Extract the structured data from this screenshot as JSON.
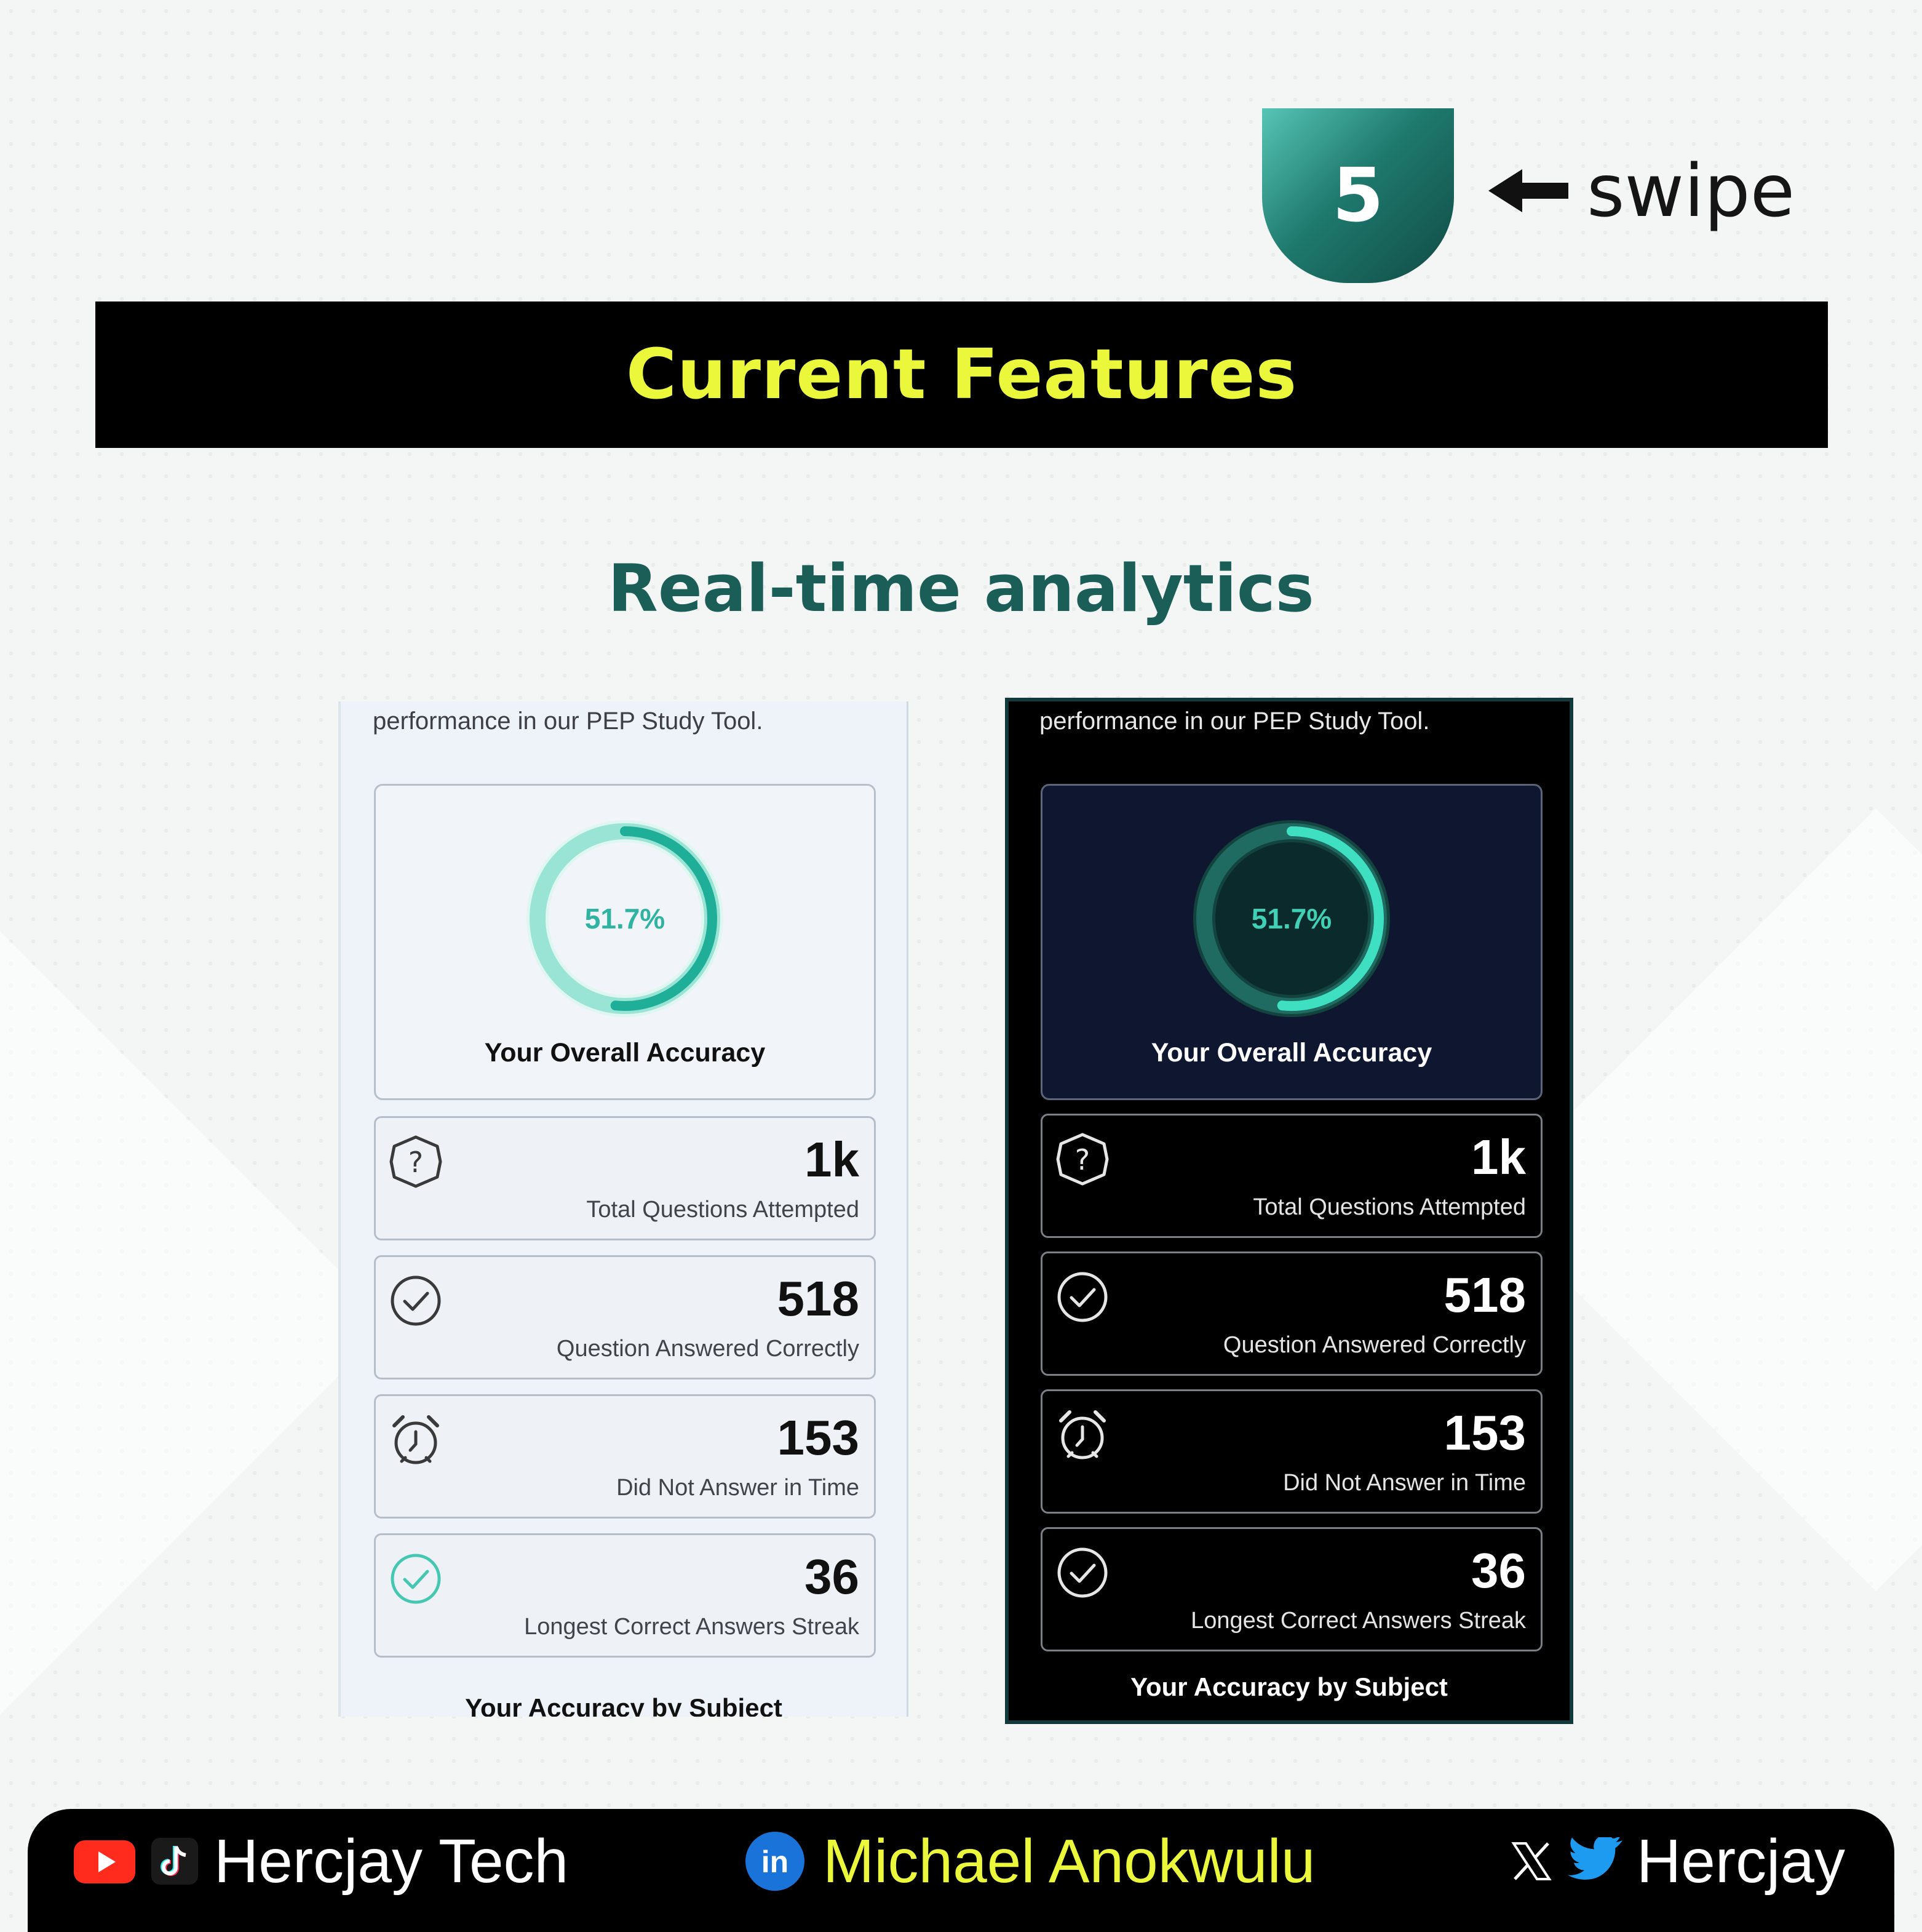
{
  "page_badge": {
    "number": "5"
  },
  "swipe": {
    "label": "swipe"
  },
  "banner": {
    "title": "Current Features"
  },
  "subtitle": "Real-time analytics",
  "colors": {
    "banner_text": "#eaf73a",
    "subtitle": "#1b5e58",
    "accent_teal": "#31b3a1"
  },
  "panels": {
    "light": {
      "intro_text": "performance in our PEP Study Tool.",
      "accuracy": {
        "percent_label": "51.7%",
        "value": 0.517,
        "title": "Your Overall Accuracy"
      },
      "stats": [
        {
          "icon": "question-icon",
          "value": "1k",
          "label": "Total Questions Attempted"
        },
        {
          "icon": "check-circle-icon",
          "value": "518",
          "label": "Question Answered Correctly"
        },
        {
          "icon": "alarm-clock-icon",
          "value": "153",
          "label": "Did Not Answer in Time"
        },
        {
          "icon": "check-circle-icon",
          "value": "36",
          "label": "Longest Correct Answers Streak"
        }
      ],
      "section_title": "Your Accuracy by Subject"
    },
    "dark": {
      "intro_text": "performance in our PEP Study Tool.",
      "accuracy": {
        "percent_label": "51.7%",
        "value": 0.517,
        "title": "Your Overall Accuracy"
      },
      "stats": [
        {
          "icon": "question-icon",
          "value": "1k",
          "label": "Total Questions Attempted"
        },
        {
          "icon": "check-circle-icon",
          "value": "518",
          "label": "Question Answered Correctly"
        },
        {
          "icon": "alarm-clock-icon",
          "value": "153",
          "label": "Did Not Answer in Time"
        },
        {
          "icon": "check-circle-icon",
          "value": "36",
          "label": "Longest Correct Answers Streak"
        }
      ],
      "section_title": "Your Accuracy by Subject"
    }
  },
  "footer": {
    "left": {
      "icons": [
        "youtube-icon",
        "tiktok-icon"
      ],
      "text": "Hercjay Tech"
    },
    "middle": {
      "icon": "linkedin-icon",
      "text": "Michael Anokwulu"
    },
    "right": {
      "icons": [
        "x-icon",
        "twitter-bird-icon"
      ],
      "text": "Hercjay"
    }
  }
}
